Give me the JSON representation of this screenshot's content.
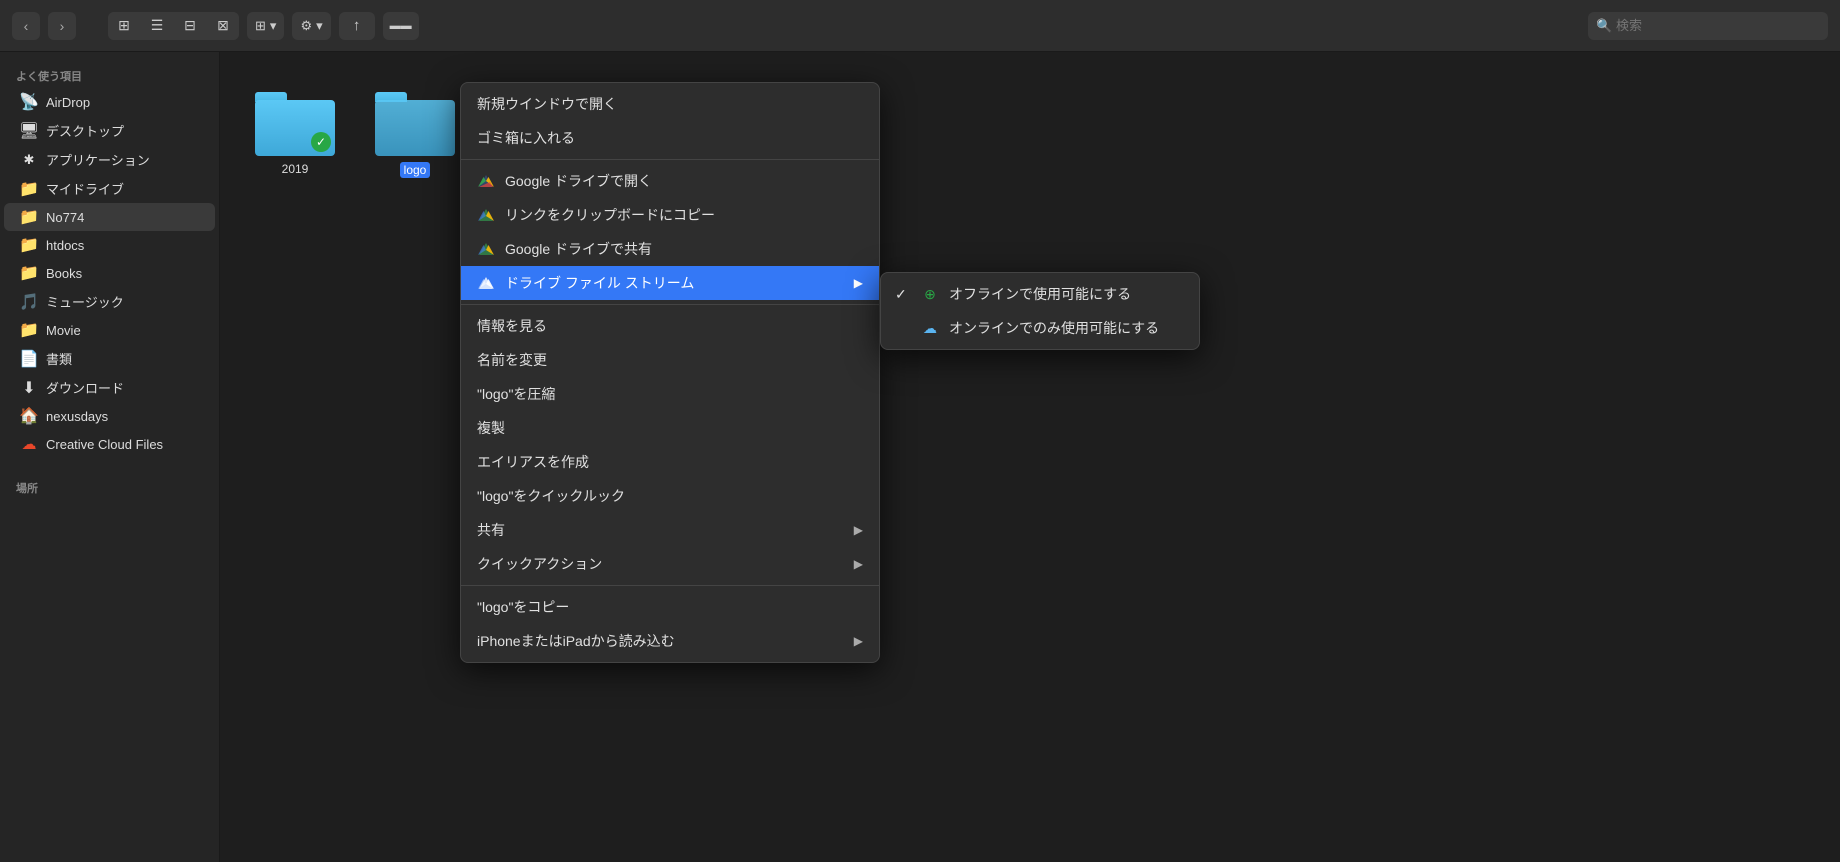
{
  "toolbar": {
    "back_label": "‹",
    "forward_label": "›",
    "view_icon_grid": "⊞",
    "view_icon_list": "☰",
    "view_icon_column": "⊟",
    "view_icon_cover": "⊠",
    "view_dropdown_icon": "⊞",
    "chevron_down": "▾",
    "gear_icon": "⚙",
    "share_icon": "↑",
    "tag_icon": "▬",
    "search_placeholder": "検索",
    "search_icon": "🔍"
  },
  "sidebar": {
    "favorites_label": "よく使う項目",
    "locations_label": "場所",
    "items": [
      {
        "id": "airdrop",
        "icon": "📡",
        "label": "AirDrop"
      },
      {
        "id": "desktop",
        "icon": "🖥",
        "label": "デスクトップ"
      },
      {
        "id": "applications",
        "icon": "🔧",
        "label": "アプリケーション"
      },
      {
        "id": "my-drive",
        "icon": "📁",
        "label": "マイドライブ"
      },
      {
        "id": "no774",
        "icon": "📁",
        "label": "No774",
        "active": true
      },
      {
        "id": "htdocs",
        "icon": "📁",
        "label": "htdocs"
      },
      {
        "id": "books",
        "icon": "📁",
        "label": "Books"
      },
      {
        "id": "music",
        "icon": "🎵",
        "label": "ミュージック"
      },
      {
        "id": "movie",
        "icon": "📁",
        "label": "Movie"
      },
      {
        "id": "documents",
        "icon": "📄",
        "label": "書類"
      },
      {
        "id": "downloads",
        "icon": "⬇",
        "label": "ダウンロード"
      },
      {
        "id": "nexusdays",
        "icon": "🏠",
        "label": "nexusdays"
      },
      {
        "id": "creative-cloud",
        "icon": "☁",
        "label": "Creative Cloud Files"
      }
    ]
  },
  "folders": [
    {
      "id": "2019",
      "name": "2019",
      "has_badge": true,
      "selected": false
    },
    {
      "id": "logo",
      "name": "logo",
      "has_badge": false,
      "selected": true
    }
  ],
  "context_menu": {
    "items": [
      {
        "id": "open-window",
        "label": "新規ウインドウで開く",
        "has_arrow": false,
        "separator_after": false,
        "icon": ""
      },
      {
        "id": "trash",
        "label": "ゴミ箱に入れる",
        "has_arrow": false,
        "separator_after": true,
        "icon": ""
      },
      {
        "id": "gdrive-open",
        "label": "Google ドライブで開く",
        "has_arrow": false,
        "separator_after": false,
        "icon": "gdrive"
      },
      {
        "id": "copy-link",
        "label": "リンクをクリップボードにコピー",
        "has_arrow": false,
        "separator_after": false,
        "icon": "gdrive"
      },
      {
        "id": "gdrive-share",
        "label": "Google ドライブで共有",
        "has_arrow": false,
        "separator_after": false,
        "icon": "gdrive"
      },
      {
        "id": "drive-file-stream",
        "label": "ドライブ ファイル ストリーム",
        "has_arrow": true,
        "separator_after": true,
        "icon": "gdrive",
        "highlighted": true
      },
      {
        "id": "info",
        "label": "情報を見る",
        "has_arrow": false,
        "separator_after": false,
        "icon": ""
      },
      {
        "id": "rename",
        "label": "名前を変更",
        "has_arrow": false,
        "separator_after": false,
        "icon": ""
      },
      {
        "id": "compress",
        "label": "\"logo\"を圧縮",
        "has_arrow": false,
        "separator_after": false,
        "icon": ""
      },
      {
        "id": "duplicate",
        "label": "複製",
        "has_arrow": false,
        "separator_after": false,
        "icon": ""
      },
      {
        "id": "make-alias",
        "label": "エイリアスを作成",
        "has_arrow": false,
        "separator_after": false,
        "icon": ""
      },
      {
        "id": "quicklook",
        "label": "\"logo\"をクイックルック",
        "has_arrow": false,
        "separator_after": false,
        "icon": ""
      },
      {
        "id": "share",
        "label": "共有",
        "has_arrow": true,
        "separator_after": false,
        "icon": ""
      },
      {
        "id": "quick-actions",
        "label": "クイックアクション",
        "has_arrow": true,
        "separator_after": true,
        "icon": ""
      },
      {
        "id": "copy",
        "label": "\"logo\"をコピー",
        "has_arrow": false,
        "separator_after": false,
        "icon": ""
      },
      {
        "id": "import-iphone",
        "label": "iPhoneまたはiPadから読み込む",
        "has_arrow": true,
        "separator_after": false,
        "icon": ""
      }
    ]
  },
  "submenu": {
    "items": [
      {
        "id": "offline",
        "label": "オフラインで使用可能にする",
        "checked": true,
        "icon": "offline"
      },
      {
        "id": "online-only",
        "label": "オンラインでのみ使用可能にする",
        "checked": false,
        "icon": "cloud"
      }
    ]
  }
}
